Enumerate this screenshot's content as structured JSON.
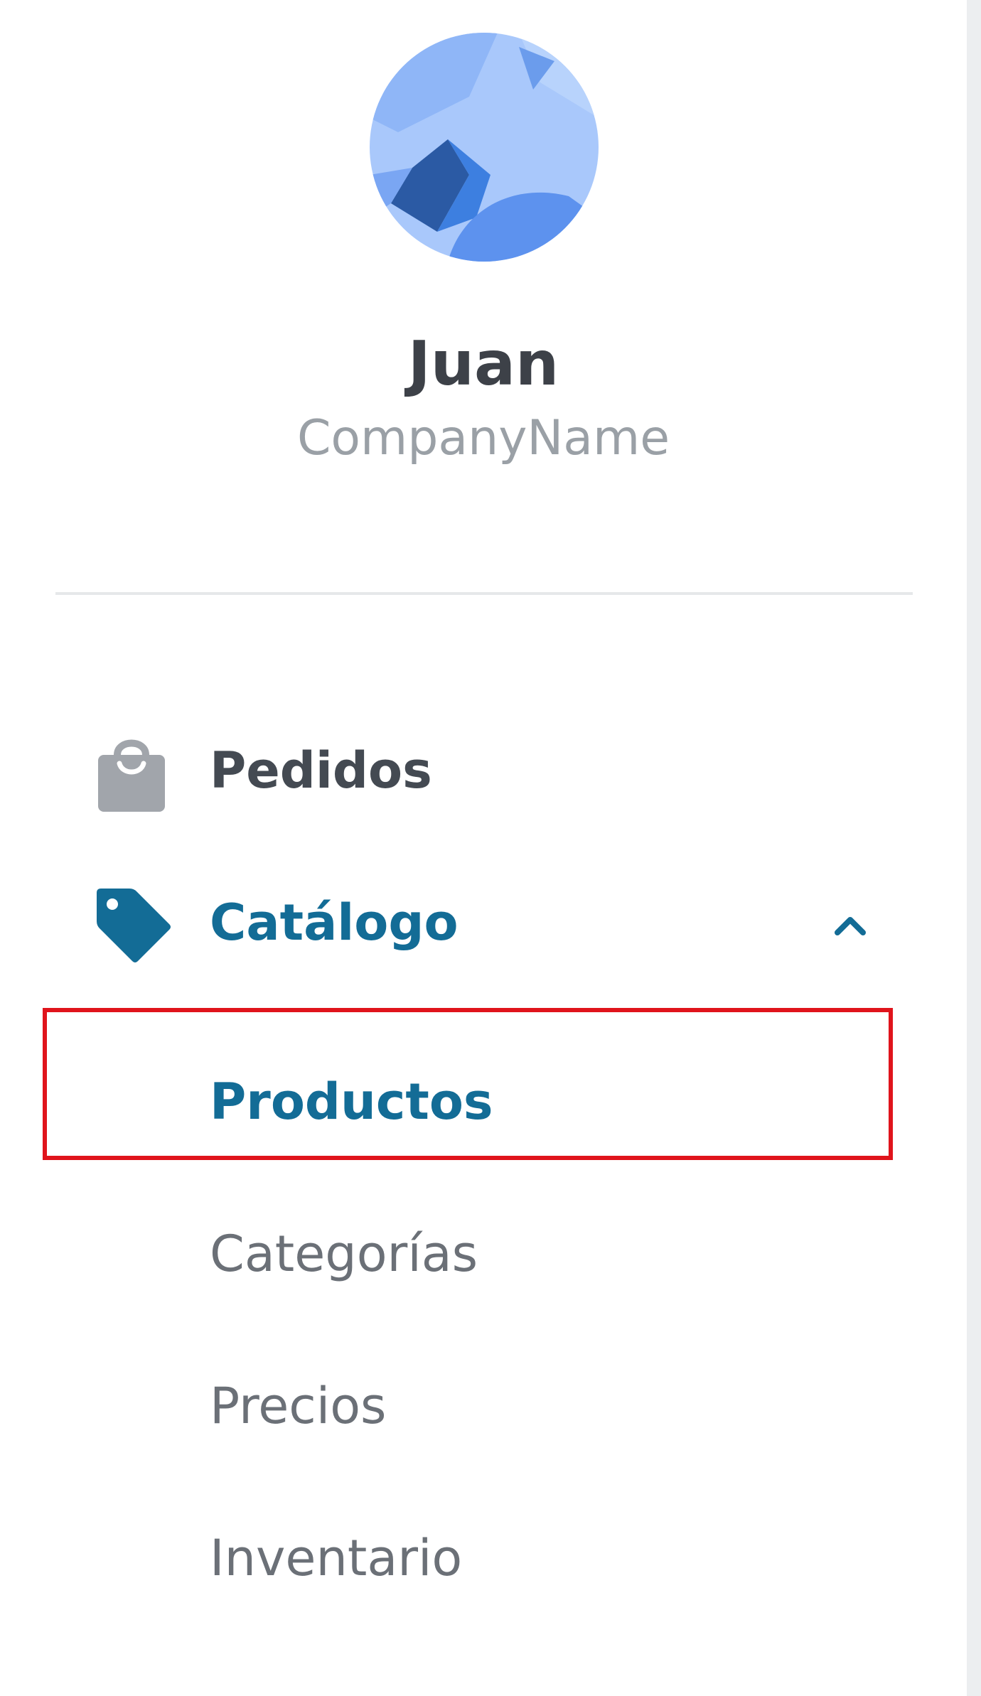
{
  "profile": {
    "name": "Juan",
    "company": "CompanyName",
    "avatar_icon": "avatar-image"
  },
  "nav": {
    "items": [
      {
        "label": "Pedidos",
        "icon": "shopping-bag-icon"
      },
      {
        "label": "Catálogo",
        "icon": "tag-icon",
        "expanded": true
      }
    ],
    "catalog_subitems": [
      {
        "label": "Productos",
        "selected": true
      },
      {
        "label": "Categorías"
      },
      {
        "label": "Precios"
      },
      {
        "label": "Inventario"
      }
    ]
  },
  "colors": {
    "accent": "#136c96",
    "highlight": "#e0141c",
    "text_primary": "#444a52",
    "text_secondary": "#6b7077"
  }
}
